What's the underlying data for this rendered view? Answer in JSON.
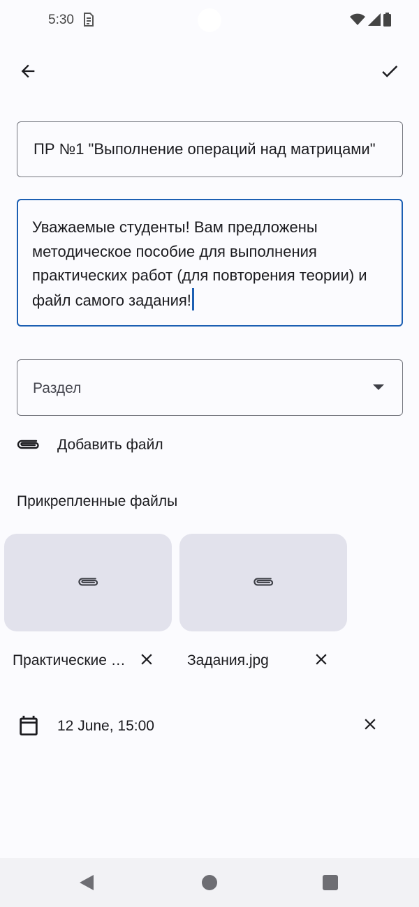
{
  "status_bar": {
    "time": "5:30",
    "icons": [
      "sim-icon",
      "wifi-icon",
      "signal-icon",
      "battery-icon"
    ]
  },
  "app_bar": {
    "back_icon": "arrow-left-icon",
    "confirm_icon": "check-icon"
  },
  "form": {
    "title_value": "ПР №1 \"Выполнение операций над матрицами\"",
    "description_value": "Уважаемые студенты! Вам предложены методическое пособие для выполнения практических работ (для повторения теории) и файл самого задания!",
    "section_placeholder": "Раздел",
    "add_file_label": "Добавить файл",
    "attached_files_title": "Прикрепленные файлы"
  },
  "attachments": [
    {
      "name": "Практические работы.pdf",
      "icon": "paperclip-icon"
    },
    {
      "name": "Задания.jpg",
      "icon": "paperclip-icon"
    }
  ],
  "deadline": {
    "value": "12 June, 15:00",
    "icon": "calendar-icon"
  },
  "colors": {
    "accent": "#1c5fb3",
    "card_bg": "#e2e2ec",
    "background": "#fbfbfe"
  }
}
